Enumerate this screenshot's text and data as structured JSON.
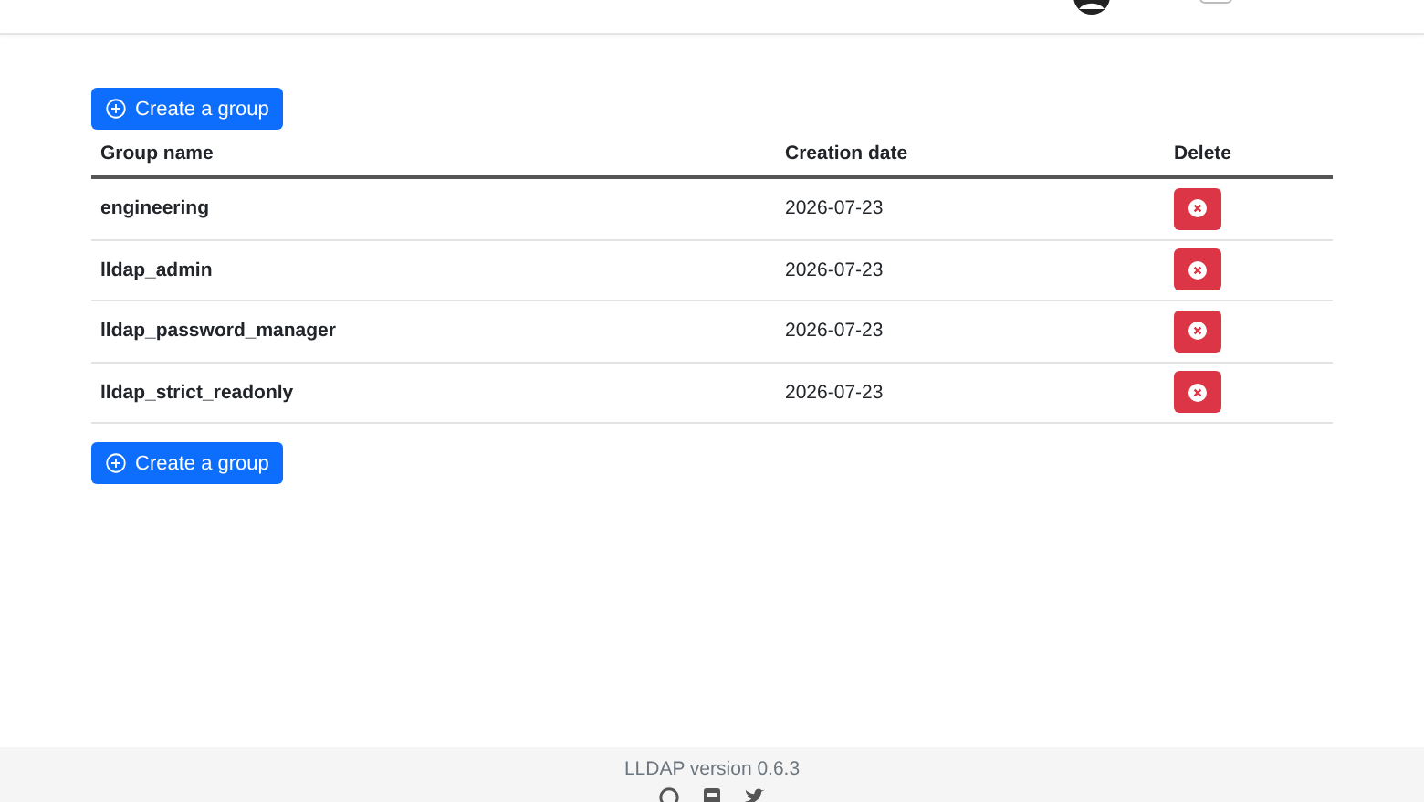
{
  "header": {
    "dark_mode_toggle": {
      "on": false
    }
  },
  "actions": {
    "create_label_top": "Create a group",
    "create_label_bottom": "Create a group"
  },
  "table": {
    "columns": [
      "Group name",
      "Creation date",
      "Delete"
    ],
    "rows": [
      {
        "name": "engineering",
        "created": "2026-07-23"
      },
      {
        "name": "lldap_admin",
        "created": "2026-07-23"
      },
      {
        "name": "lldap_password_manager",
        "created": "2026-07-23"
      },
      {
        "name": "lldap_strict_readonly",
        "created": "2026-07-23"
      }
    ]
  },
  "footer": {
    "version": "LLDAP version 0.6.3"
  }
}
